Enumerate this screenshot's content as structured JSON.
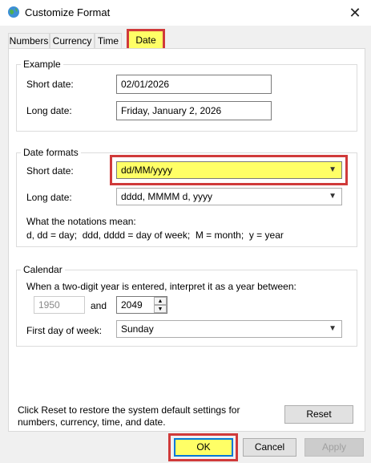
{
  "window": {
    "title": "Customize Format",
    "close_symbol": "✕"
  },
  "tabs": [
    {
      "label": "Numbers"
    },
    {
      "label": "Currency"
    },
    {
      "label": "Time"
    },
    {
      "label": "Date"
    }
  ],
  "example": {
    "group_label": "Example",
    "short_label": "Short date:",
    "short_value": "02/01/2026",
    "long_label": "Long date:",
    "long_value": "Friday, January 2, 2026"
  },
  "date_formats": {
    "group_label": "Date formats",
    "short_label": "Short date:",
    "short_value": "dd/MM/yyyy",
    "long_label": "Long date:",
    "long_value": "dddd, MMMM d, yyyy",
    "notation_title": "What the notations mean:",
    "notation_text": "d, dd = day;  ddd, dddd = day of week;  M = month;  y = year"
  },
  "calendar": {
    "group_label": "Calendar",
    "two_digit_text": "When a two-digit year is entered, interpret it as a year between:",
    "year_from": "1950",
    "and_text": "and",
    "year_to": "2049",
    "first_day_label": "First day of week:",
    "first_day_value": "Sunday"
  },
  "reset": {
    "info_line1": "Click Reset to restore the system default settings for",
    "info_line2": "numbers, currency, time, and date.",
    "button_label": "Reset"
  },
  "footer": {
    "ok_label": "OK",
    "cancel_label": "Cancel",
    "apply_label": "Apply"
  },
  "colors": {
    "highlight": "#ffff66",
    "annotation_box": "#d03a3a",
    "focus_blue": "#0078d7"
  }
}
